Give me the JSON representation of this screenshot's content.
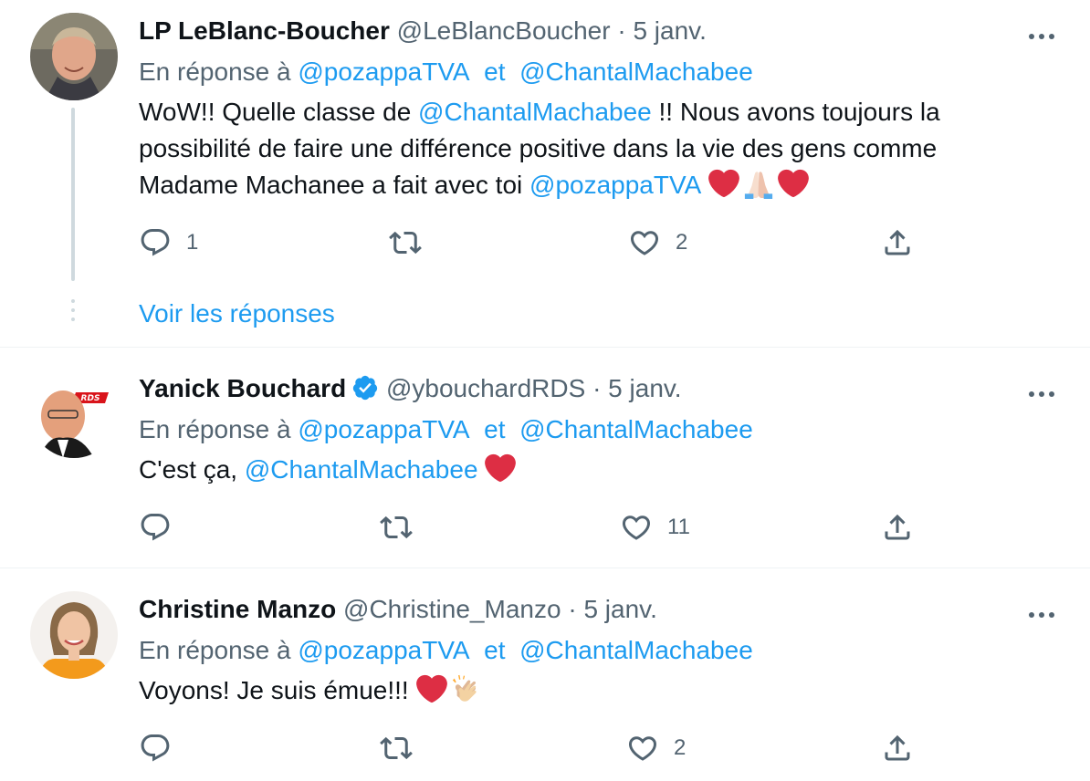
{
  "colors": {
    "accent": "#1d9bf0",
    "muted": "#536471",
    "text": "#0f1419",
    "heart": "#e0245e"
  },
  "tweets": [
    {
      "name": "LP LeBlanc-Boucher",
      "handle": "@LeBlancBoucher",
      "separator": "·",
      "date": "5 janv.",
      "verified": false,
      "reply_prefix": "En réponse à",
      "reply_user1": "@pozappaTVA",
      "reply_and": "et",
      "reply_user2": "@ChantalMachabee",
      "text_part1": "WoW!! Quelle classe de ",
      "text_mention1": "@ChantalMachabee",
      "text_part2": " !! Nous avons toujours la possibilité de faire une différence positive dans la vie des gens comme Madame Machanee a fait avec toi ",
      "text_mention2": "@pozappaTVA",
      "emojis": [
        "red-heart",
        "folded-hands",
        "red-heart"
      ],
      "reply_count": "1",
      "retweet_count": "",
      "like_count": "2",
      "see_replies": "Voir les réponses"
    },
    {
      "name": "Yanick Bouchard",
      "handle": "@ybouchardRDS",
      "separator": "·",
      "date": "5 janv.",
      "verified": true,
      "reply_prefix": "En réponse à",
      "reply_user1": "@pozappaTVA",
      "reply_and": "et",
      "reply_user2": "@ChantalMachabee",
      "text_part1": "C'est ça, ",
      "text_mention1": "@ChantalMachabee",
      "emojis": [
        "red-heart"
      ],
      "reply_count": "",
      "retweet_count": "",
      "like_count": "11"
    },
    {
      "name": "Christine Manzo",
      "handle": "@Christine_Manzo",
      "separator": "·",
      "date": "5 janv.",
      "verified": false,
      "reply_prefix": "En réponse à",
      "reply_user1": "@pozappaTVA",
      "reply_and": "et",
      "reply_user2": "@ChantalMachabee",
      "text_part1": "Voyons! Je suis émue!!! ",
      "emojis": [
        "red-heart",
        "clapping-hands"
      ],
      "reply_count": "",
      "retweet_count": "",
      "like_count": "2"
    }
  ]
}
